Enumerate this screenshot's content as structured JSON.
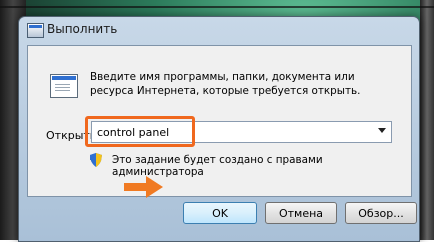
{
  "window": {
    "title": "Выполнить"
  },
  "dialog": {
    "description": "Введите имя программы, папки, документа или ресурса Интернета, которые требуется открыть.",
    "open_label": "Открыть:",
    "command_value": "control panel",
    "admin_note": "Это задание будет создано с правами администратора"
  },
  "buttons": {
    "ok": "OK",
    "cancel": "Отмена",
    "browse": "Обзор..."
  },
  "colors": {
    "highlight": "#f0681e",
    "arrow": "#f07a22"
  }
}
